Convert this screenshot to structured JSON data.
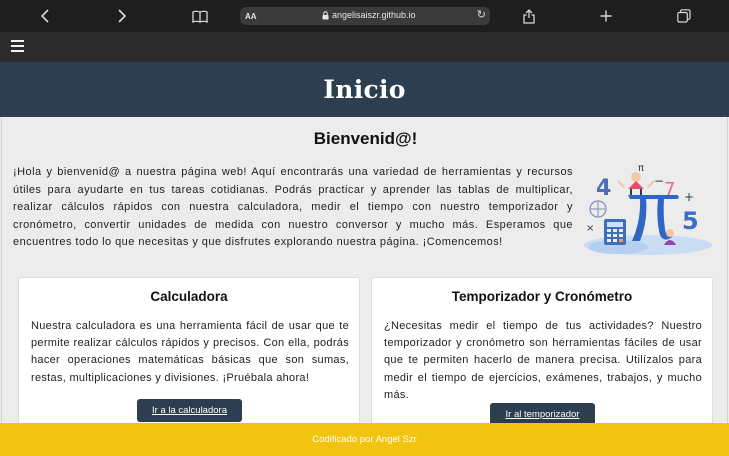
{
  "browser": {
    "url": "angelisaiszr.github.io",
    "text_size_label": "AA",
    "icons": {
      "back": "chevron-left-icon",
      "forward": "chevron-right-icon",
      "bookmarks": "book-icon",
      "reload": "reload-icon",
      "share": "share-icon",
      "new_tab": "plus-icon",
      "tabs": "tabs-icon"
    }
  },
  "nav": {
    "menu_icon": "hamburger-icon"
  },
  "header": {
    "title": "Inicio"
  },
  "main": {
    "welcome_title": "Bienvenid@!",
    "intro": "¡Hola y bienvenid@ a nuestra página web! Aquí encontrarás una variedad de herramientas y recursos útiles para ayudarte en tus tareas cotidianas. Podrás practicar y aprender las tablas de multiplicar, realizar cálculos rápidos con nuestra calculadora, medir el tiempo con nuestro temporizador y cronómetro, convertir unidades de medida con nuestro conversor y mucho más. Esperamos que encuentres todo lo que necesitas y que disfrutes explorando nuestra página. ¡Comencemos!",
    "hero_digits": [
      "4",
      "7",
      "5",
      "π",
      "+",
      "−",
      "×"
    ],
    "cards": [
      {
        "title": "Calculadora",
        "text": "Nuestra calculadora es una herramienta fácil de usar que te permite realizar cálculos rápidos y precisos. Con ella, podrás hacer operaciones matemáticas básicas que son sumas, restas, multiplicaciones y divisiones. ¡Pruébala ahora!",
        "button": "Ir a la calculadora"
      },
      {
        "title": "Temporizador y Cronómetro",
        "text": "¿Necesitas medir el tiempo de tus actividades? Nuestro temporizador y cronómetro son herramientas fáciles de usar que te permiten hacerlo de manera precisa. Utilízalos para medir el tiempo de ejercicios, exámenes, trabajos, y mucho más.",
        "button": "Ir al temporizador"
      }
    ]
  },
  "footer": {
    "text": "Codificado por Angel Szr"
  },
  "colors": {
    "header_bg": "#2c3e50",
    "footer_bg": "#f1c40f",
    "button_bg": "#2c3e50",
    "page_bg": "#ececec",
    "browser_bar": "#1e1e1e"
  }
}
